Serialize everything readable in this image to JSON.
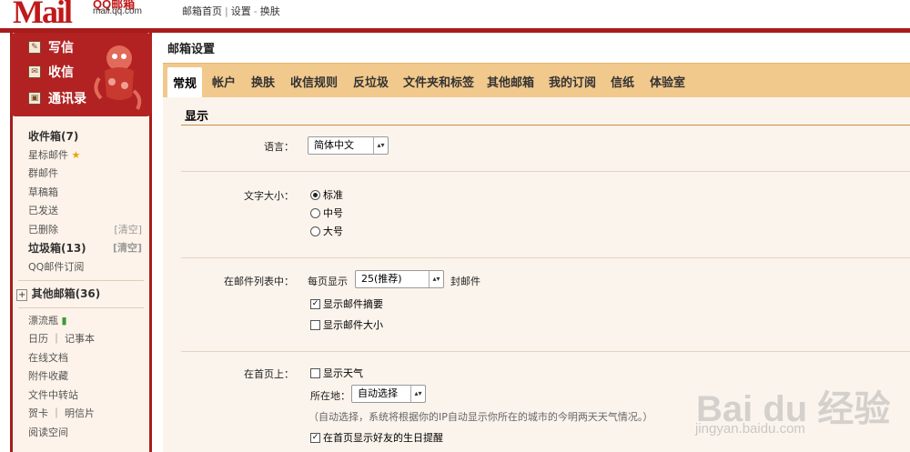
{
  "logo": {
    "text": "Mail",
    "brand": "QQ邮箱",
    "url": "mail.qq.com"
  },
  "top_links": [
    "邮箱首页",
    "设置",
    "换肤"
  ],
  "sidebar": {
    "actions": [
      {
        "icon": "compose-icon",
        "label": "写信"
      },
      {
        "icon": "inbox-icon",
        "label": "收信"
      },
      {
        "icon": "contacts-icon",
        "label": "通讯录"
      }
    ],
    "folders": [
      {
        "label": "收件箱(7)",
        "bold": true
      },
      {
        "label": "星标邮件"
      },
      {
        "label": "群邮件"
      },
      {
        "label": "草稿箱"
      },
      {
        "label": "已发送"
      },
      {
        "label": "已删除",
        "action": "[清空]"
      },
      {
        "label": "垃圾箱(13)",
        "bold": true,
        "action": "[清空]"
      },
      {
        "label": "QQ邮件订阅"
      }
    ],
    "other_mail": "其他邮箱(36)",
    "tools": [
      "漂流瓶",
      "日历 ｜ 记事本",
      "在线文档",
      "附件收藏",
      "文件中转站",
      "贺卡 ｜ 明信片",
      "阅读空间"
    ]
  },
  "page_title": "邮箱设置",
  "tabs": [
    "常规",
    "帐户",
    "换肤",
    "收信规则",
    "反垃圾",
    "文件夹和标签",
    "其他邮箱",
    "我的订阅",
    "信纸",
    "体验室"
  ],
  "settings": {
    "section": "显示",
    "language": {
      "label": "语言：",
      "value": "简体中文"
    },
    "font_size": {
      "label": "文字大小：",
      "options": [
        "标准",
        "中号",
        "大号"
      ],
      "selected": 0
    },
    "mail_list": {
      "label": "在邮件列表中：",
      "per_page_prefix": "每页显示",
      "per_page_value": "25(推荐)",
      "per_page_suffix": "封邮件",
      "show_summary": "显示邮件摘要",
      "show_summary_checked": true,
      "show_size": "显示邮件大小",
      "show_size_checked": false
    },
    "home_page": {
      "label": "在首页上：",
      "show_weather": "显示天气",
      "show_weather_checked": false,
      "location_label": "所在地：",
      "location_value": "自动选择",
      "hint": "（自动选择，系统将根据你的IP自动显示你所在的城市的今明两天天气情况。）",
      "birthday": "在首页显示好友的生日提醒",
      "birthday_checked": true
    }
  },
  "watermark": {
    "line1": "Bai du 经验",
    "line2": "jingyan.baidu.com"
  },
  "colors": {
    "brand_red": "#a81c1c",
    "tab_bar": "#f2c98c",
    "content_bg": "#fbf4ec"
  }
}
